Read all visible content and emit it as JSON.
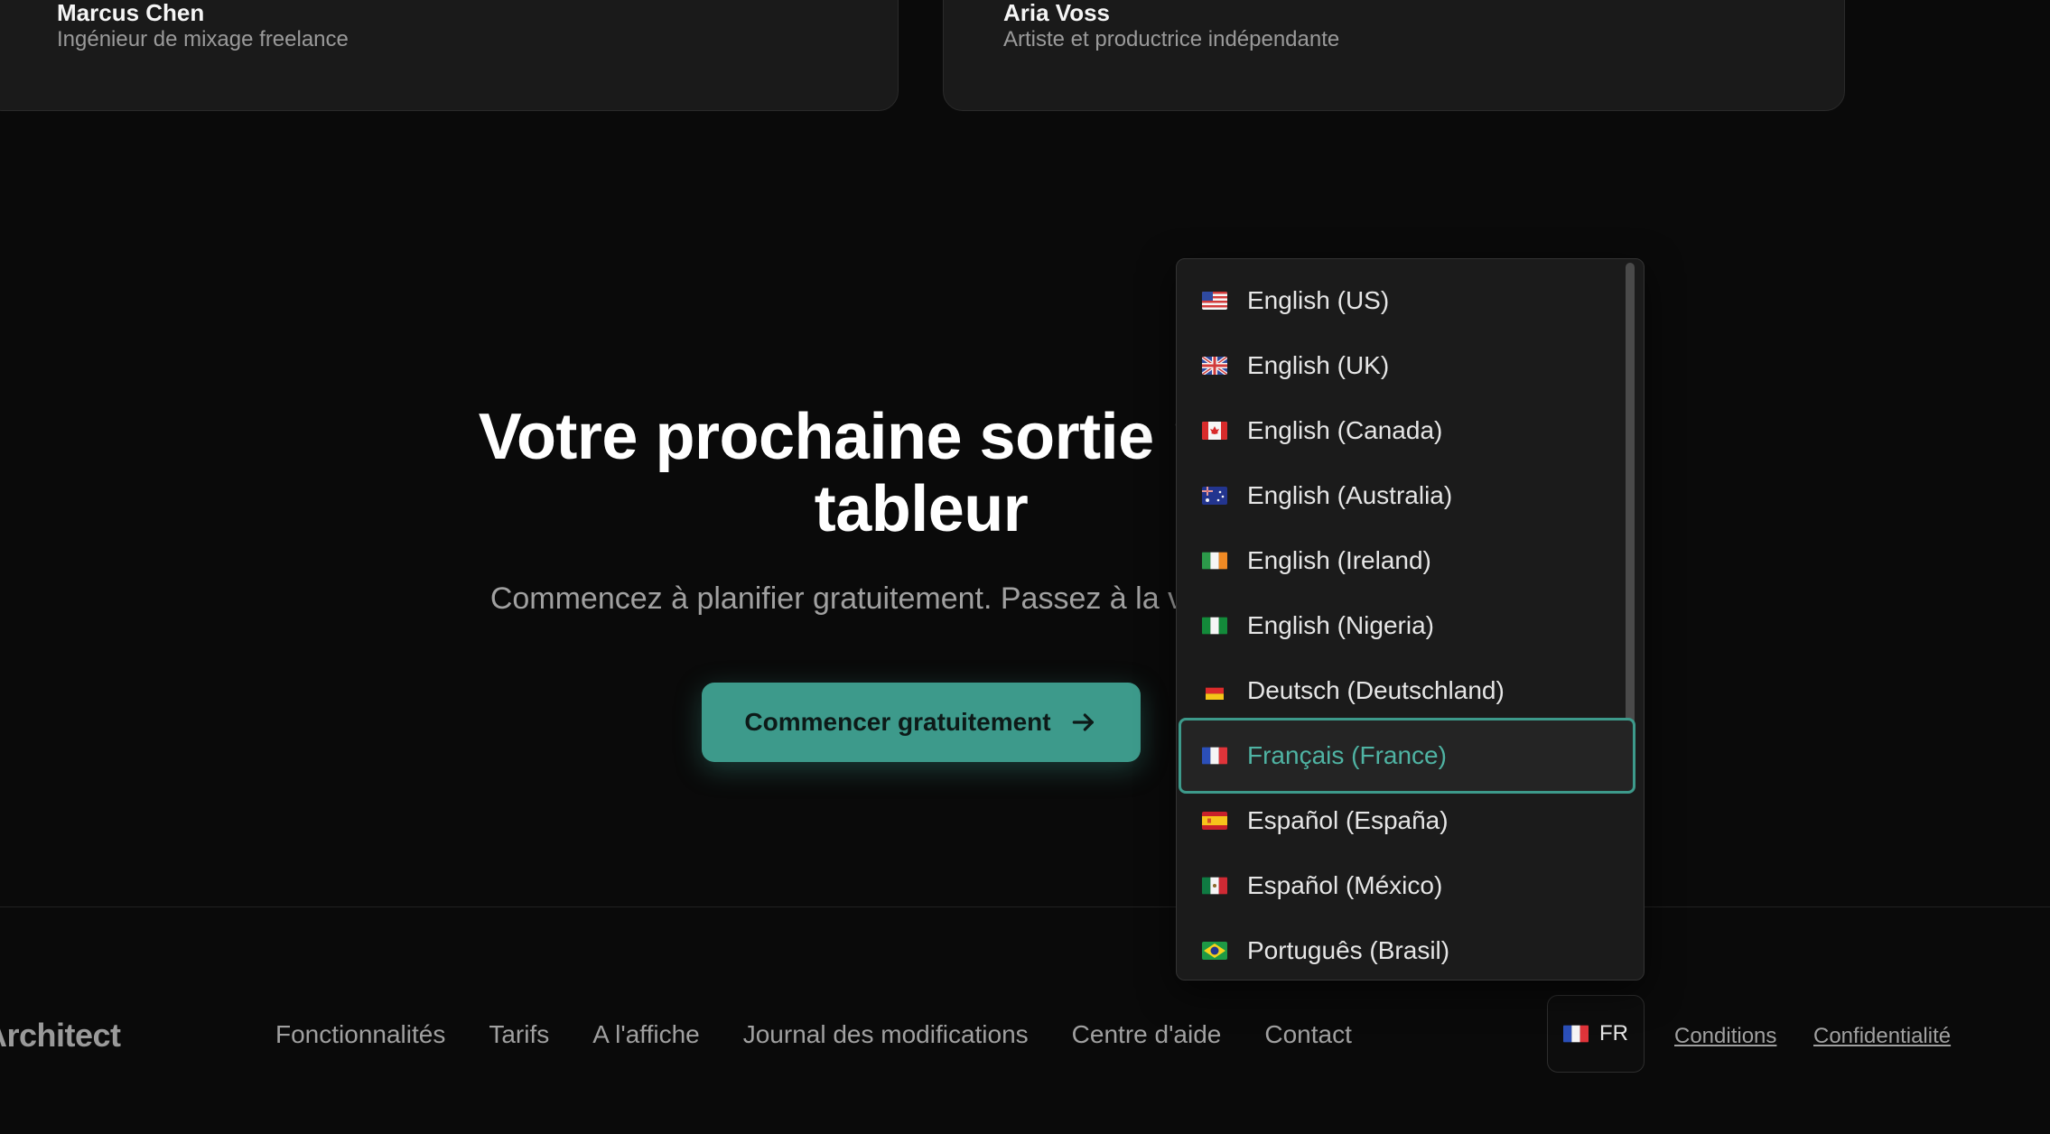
{
  "testimonials": [
    {
      "name": "Marcus Chen",
      "role": "Ingénieur de mixage freelance"
    },
    {
      "name": "Aria Voss",
      "role": "Artiste et productrice indépendante"
    }
  ],
  "cta": {
    "title_line1": "Votre prochaine sortie mérite",
    "title_line2": "tableur",
    "subtitle": "Commencez à planifier gratuitement. Passez à la version supér",
    "button_label": "Commencer gratuitement"
  },
  "footer": {
    "logo": "Architect",
    "nav": [
      "Fonctionnalités",
      "Tarifs",
      "A l'affiche",
      "Journal des modifications",
      "Centre d'aide",
      "Contact"
    ],
    "language_code": "FR",
    "terms": "Conditions",
    "privacy": "Confidentialité"
  },
  "language_dropdown": {
    "selected": "Français (France)",
    "options": [
      {
        "label": "English (US)",
        "flag": "us-flag-icon"
      },
      {
        "label": "English (UK)",
        "flag": "uk-flag-icon"
      },
      {
        "label": "English (Canada)",
        "flag": "canada-flag-icon"
      },
      {
        "label": "English (Australia)",
        "flag": "australia-flag-icon"
      },
      {
        "label": "English (Ireland)",
        "flag": "ireland-flag-icon"
      },
      {
        "label": "English (Nigeria)",
        "flag": "nigeria-flag-icon"
      },
      {
        "label": "Deutsch (Deutschland)",
        "flag": "germany-flag-icon"
      },
      {
        "label": "Français (France)",
        "flag": "france-flag-icon"
      },
      {
        "label": "Español (España)",
        "flag": "spain-flag-icon"
      },
      {
        "label": "Español (México)",
        "flag": "mexico-flag-icon"
      },
      {
        "label": "Português (Brasil)",
        "flag": "brazil-flag-icon"
      }
    ]
  },
  "colors": {
    "accent": "#3d9a8b",
    "accent_text": "#4fb3a3",
    "background": "#0a0a0a",
    "card": "#1a1a1a"
  }
}
